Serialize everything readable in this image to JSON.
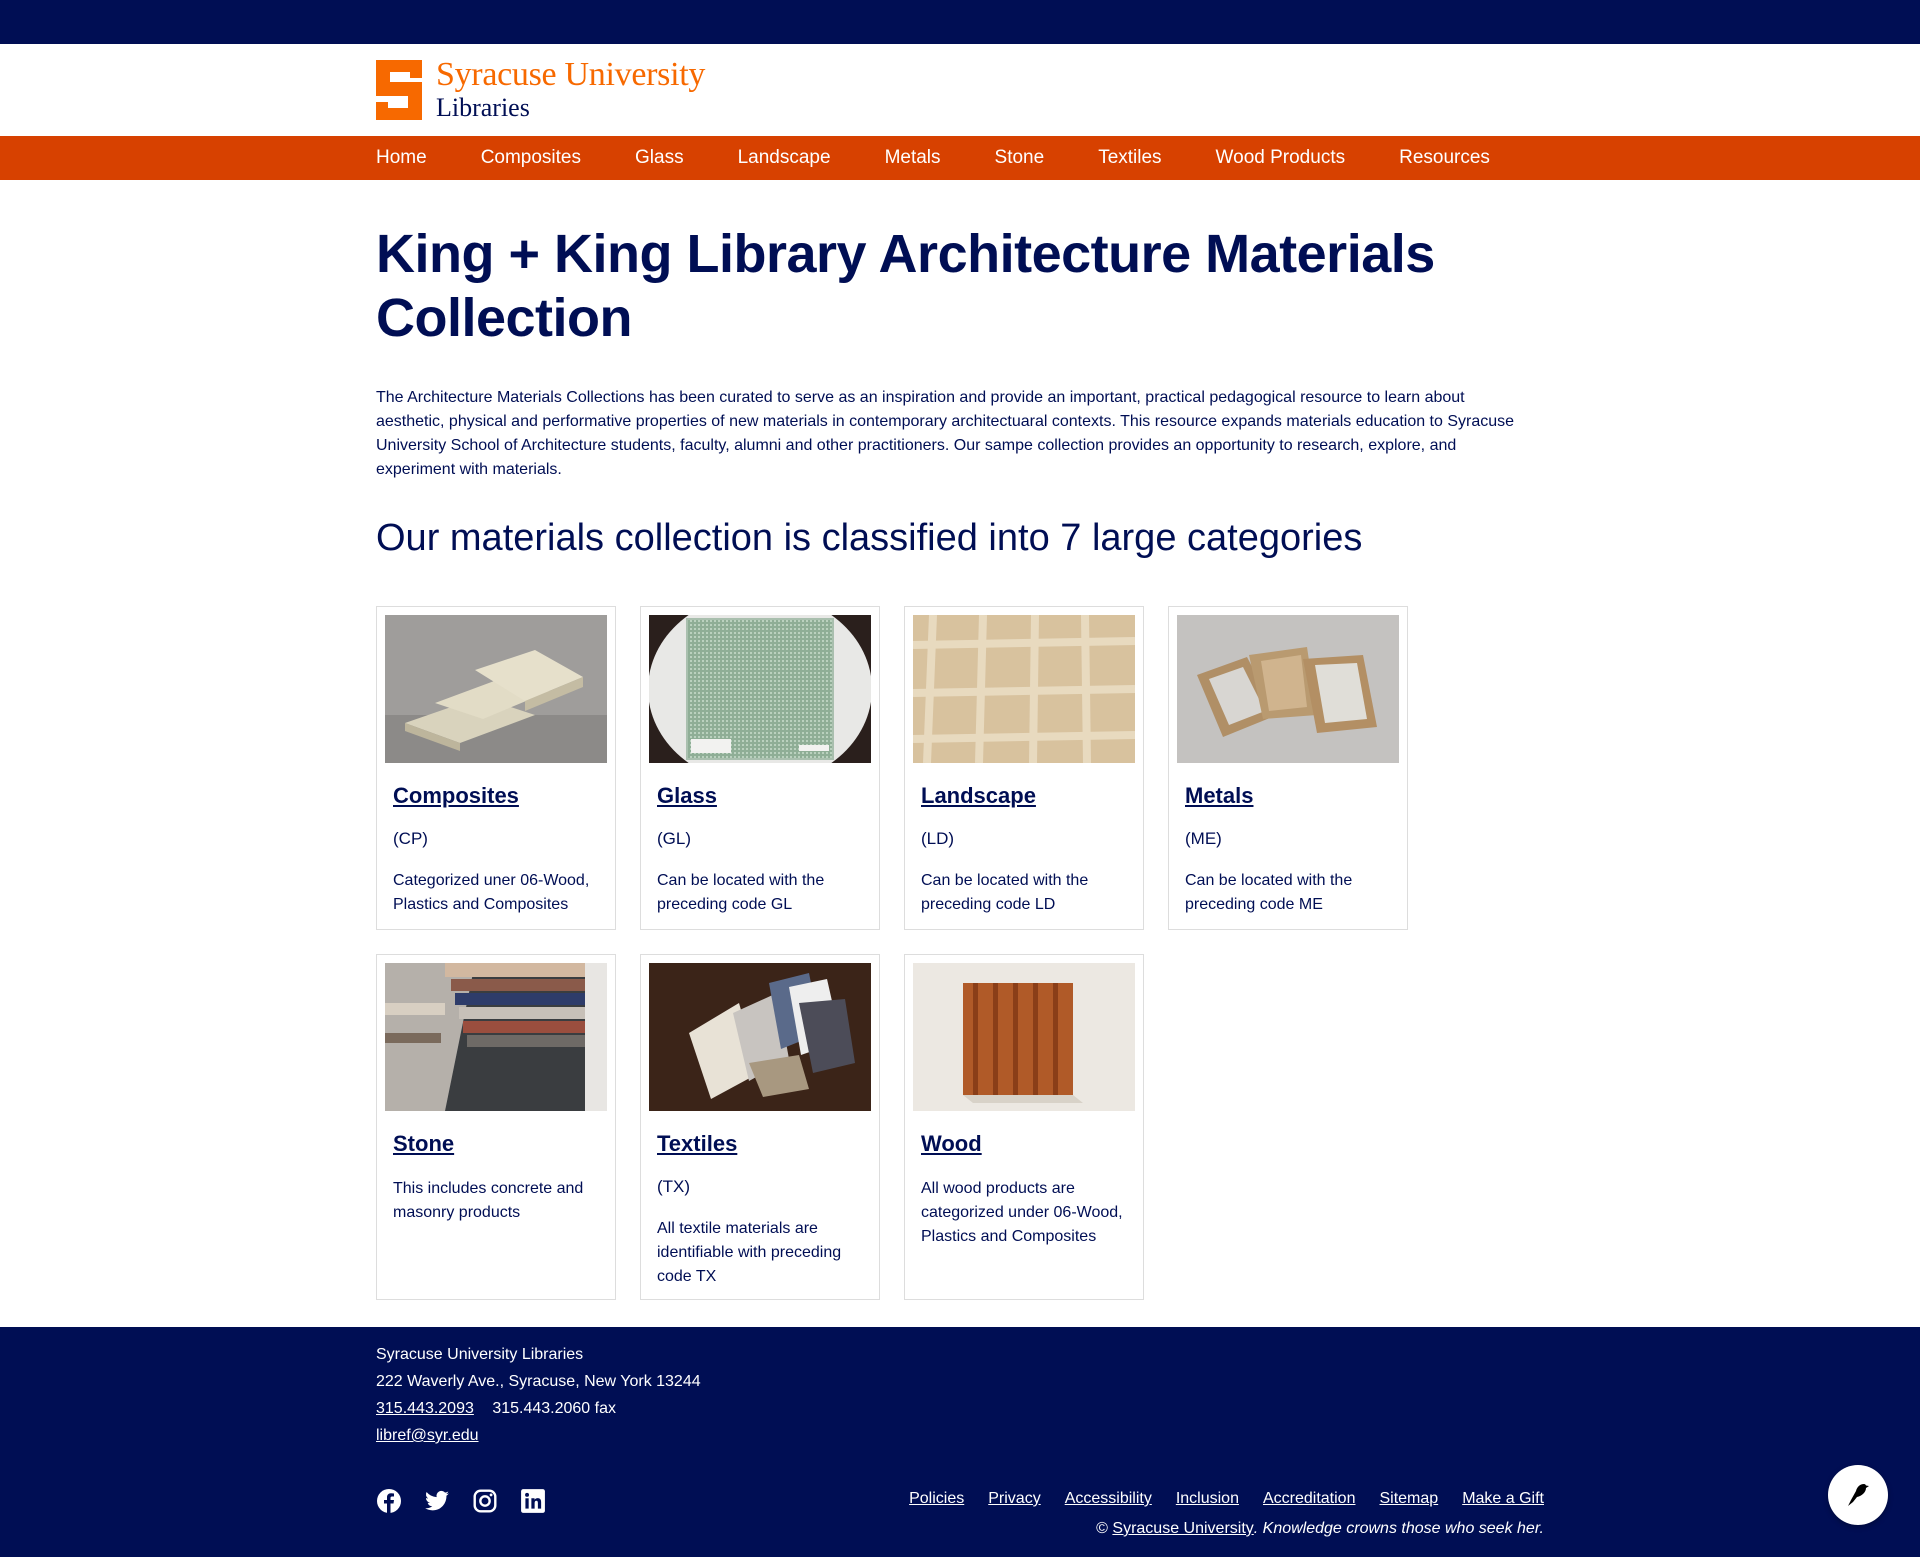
{
  "brand": {
    "line1": "Syracuse University",
    "line2": "Libraries",
    "orange": "#f76900",
    "navy": "#000e54",
    "nav_orange": "#d74100"
  },
  "nav": [
    "Home",
    "Composites",
    "Glass",
    "Landscape",
    "Metals",
    "Stone",
    "Textiles",
    "Wood Products",
    "Resources"
  ],
  "page": {
    "title": "King + King Library Architecture Materials Collection",
    "intro": "The Architecture Materials Collections has been curated to serve as an inspiration and provide an important, practical pedagogical resource to learn about aesthetic, physical and performative properties of new materials in contemporary architectuaral contexts. This resource expands materials education to Syracuse University School of Architecture students, faculty, alumni and other practitioners. Our sampe collection provides an opportunity to research, explore, and experiment with materials.",
    "subtitle": "Our materials collection is classified into 7 large categories"
  },
  "categories": [
    {
      "title": "Composites",
      "code": "(CP)",
      "desc": "Categorized uner 06-Wood, Plastics and Composites",
      "image": "composite-blocks-photo"
    },
    {
      "title": "Glass",
      "code": "(GL)",
      "desc": "Can be located with the preceding code GL",
      "image": "glass-panel-photo"
    },
    {
      "title": "Landscape",
      "code": "(LD)",
      "desc": "Can be located with the preceding code LD",
      "image": "landscape-mesh-photo"
    },
    {
      "title": "Metals",
      "code": "(ME)",
      "desc": "Can be located with the preceding code ME",
      "image": "metal-samples-photo"
    },
    {
      "title": "Stone",
      "code": "",
      "desc": "This includes concrete and masonry products",
      "image": "stone-samples-photo"
    },
    {
      "title": "Textiles",
      "code": "(TX)",
      "desc": "All textile materials are identifiable with preceding code TX",
      "image": "textile-swatches-photo"
    },
    {
      "title": "Wood",
      "code": "",
      "desc": "All wood products are categorized under 06-Wood, Plastics and Composites",
      "image": "wood-slats-photo"
    }
  ],
  "footer": {
    "org": "Syracuse University Libraries",
    "address": "222 Waverly Ave., Syracuse, New York 13244",
    "phone": "315.443.2093",
    "fax": "315.443.2060 fax",
    "email": "libref@syr.edu",
    "links": [
      "Policies",
      "Privacy",
      "Accessibility",
      "Inclusion",
      "Accreditation",
      "Sitemap",
      "Make a Gift"
    ],
    "copyright_prefix": "©",
    "copyright_link": "Syracuse University",
    "motto": ". Knowledge crowns those who seek her.",
    "social_icons": [
      "facebook-icon",
      "twitter-icon",
      "instagram-icon",
      "linkedin-icon"
    ]
  }
}
